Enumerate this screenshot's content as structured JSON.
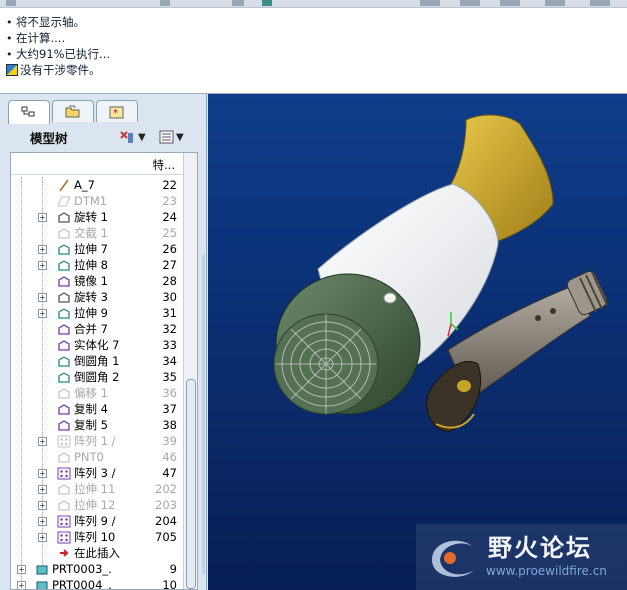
{
  "messages": [
    {
      "text": "将不显示轴。",
      "type": "info"
    },
    {
      "text": "在计算....",
      "type": "info"
    },
    {
      "text": "大约91%已执行...",
      "type": "info"
    },
    {
      "text": "没有干涉零件。",
      "type": "warning"
    }
  ],
  "tabs": [
    {
      "icon": "model-tree-icon",
      "active": true
    },
    {
      "icon": "folder-browser-icon",
      "active": false
    },
    {
      "icon": "favorites-icon",
      "active": false
    }
  ],
  "tree": {
    "title": "模型树",
    "column_header": "特...",
    "rows": [
      {
        "label": "A_7",
        "num": "22",
        "icon": "axis-icon",
        "dim": false,
        "expander": false
      },
      {
        "label": "DTM1",
        "num": "23",
        "icon": "datum-plane-icon",
        "dim": true,
        "expander": false
      },
      {
        "label": "旋转 1",
        "num": "24",
        "icon": "revolve-icon",
        "dim": false,
        "expander": true
      },
      {
        "label": "交截 1",
        "num": "25",
        "icon": "intersect-icon",
        "dim": true,
        "expander": false
      },
      {
        "label": "拉伸 7",
        "num": "26",
        "icon": "extrude-icon",
        "dim": false,
        "expander": true
      },
      {
        "label": "拉伸 8",
        "num": "27",
        "icon": "extrude-icon",
        "dim": false,
        "expander": true
      },
      {
        "label": "镜像 1",
        "num": "28",
        "icon": "mirror-icon",
        "dim": false,
        "expander": false
      },
      {
        "label": "旋转 3",
        "num": "30",
        "icon": "revolve-icon",
        "dim": false,
        "expander": true
      },
      {
        "label": "拉伸 9",
        "num": "31",
        "icon": "extrude-icon",
        "dim": false,
        "expander": true
      },
      {
        "label": "合并 7",
        "num": "32",
        "icon": "merge-icon",
        "dim": false,
        "expander": false
      },
      {
        "label": "实体化 7",
        "num": "33",
        "icon": "solidify-icon",
        "dim": false,
        "expander": false
      },
      {
        "label": "倒圆角 1",
        "num": "34",
        "icon": "round-icon",
        "dim": false,
        "expander": false
      },
      {
        "label": "倒圆角 2",
        "num": "35",
        "icon": "round-icon",
        "dim": false,
        "expander": false
      },
      {
        "label": "偏移 1",
        "num": "36",
        "icon": "offset-icon",
        "dim": true,
        "expander": false
      },
      {
        "label": "复制 4",
        "num": "37",
        "icon": "copy-icon",
        "dim": false,
        "expander": false
      },
      {
        "label": "复制 5",
        "num": "38",
        "icon": "copy-icon",
        "dim": false,
        "expander": false
      },
      {
        "label": "阵列 1 /",
        "num": "39",
        "icon": "pattern-icon",
        "dim": true,
        "expander": true
      },
      {
        "label": "PNT0",
        "num": "46",
        "icon": "datum-point-icon",
        "dim": true,
        "expander": false
      },
      {
        "label": "阵列 3 /",
        "num": "47",
        "icon": "pattern-icon",
        "dim": false,
        "expander": true
      },
      {
        "label": "拉伸 11",
        "num": "202",
        "icon": "extrude-icon",
        "dim": true,
        "expander": true
      },
      {
        "label": "拉伸 12",
        "num": "203",
        "icon": "extrude-icon",
        "dim": true,
        "expander": true
      },
      {
        "label": "阵列 9 /",
        "num": "204",
        "icon": "pattern-icon",
        "dim": false,
        "expander": true
      },
      {
        "label": "阵列 10",
        "num": "705",
        "icon": "pattern-icon",
        "dim": false,
        "expander": true
      },
      {
        "label": "在此插入",
        "num": "",
        "icon": "insert-here-icon",
        "dim": false,
        "expander": false
      }
    ],
    "parts": [
      {
        "label": "PRT0003_.",
        "num": "9"
      },
      {
        "label": "PRT0004_.",
        "num": "10"
      }
    ]
  },
  "viewport": {
    "model": "hair-dryer",
    "watermark_title": "野火论坛",
    "watermark_url": "www.proewildfire.cn",
    "colors": {
      "body": "#ffffff",
      "nozzle": "#c9a527",
      "motor": "#3e5a3d",
      "handle": "#8a8378",
      "background": "#0b2f73"
    }
  }
}
